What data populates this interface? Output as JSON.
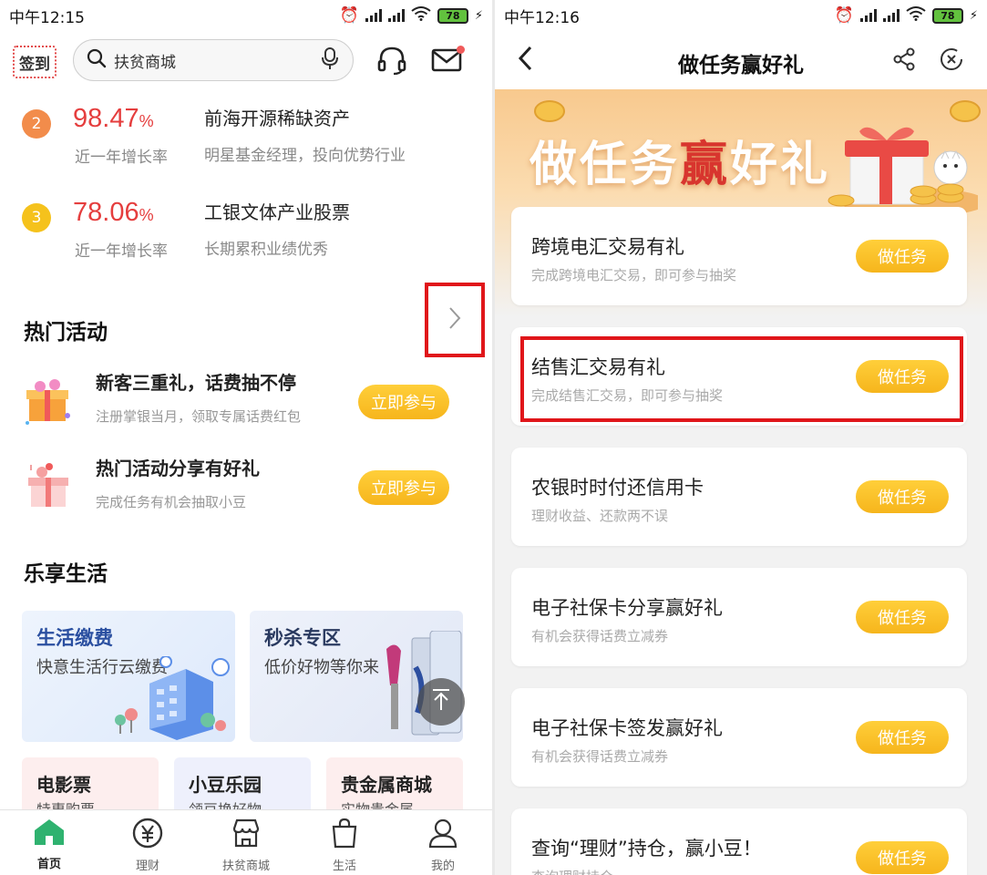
{
  "left": {
    "status": {
      "time": "中午12:15",
      "battery": "78"
    },
    "header": {
      "signin_label": "签到",
      "search_text": "扶贫商城"
    },
    "funds": [
      {
        "rank": "2",
        "rate": "98.47",
        "rate_unit": "%",
        "rate_label": "近一年增长率",
        "name": "前海开源稀缺资产",
        "desc": "明星基金经理，投向优势行业",
        "badge_color": "#f28c4b"
      },
      {
        "rank": "3",
        "rate": "78.06",
        "rate_unit": "%",
        "rate_label": "近一年增长率",
        "name": "工银文体产业股票",
        "desc": "长期累积业绩优秀",
        "badge_color": "#f5c21c"
      }
    ],
    "hot": {
      "title": "热门活动",
      "items": [
        {
          "title": "新客三重礼，话费抽不停",
          "desc": "注册掌银当月，领取专属话费红包",
          "button": "立即参与"
        },
        {
          "title": "热门活动分享有好礼",
          "desc": "完成任务有机会抽取小豆",
          "button": "立即参与"
        }
      ]
    },
    "life": {
      "title": "乐享生活",
      "cards": [
        {
          "title": "生活缴费",
          "sub": "快意生活行云缴费"
        },
        {
          "title": "秒杀专区",
          "sub": "低价好物等你来"
        }
      ],
      "small_cards": [
        {
          "title": "电影票",
          "sub": "特惠购票"
        },
        {
          "title": "小豆乐园",
          "sub": "领豆换好物"
        },
        {
          "title": "贵金属商城",
          "sub": "实物贵金属"
        }
      ]
    },
    "tabs": [
      {
        "label": "首页"
      },
      {
        "label": "理财"
      },
      {
        "label": "扶贫商城"
      },
      {
        "label": "生活"
      },
      {
        "label": "我的"
      }
    ]
  },
  "right": {
    "status": {
      "time": "中午12:16",
      "battery": "78"
    },
    "header": {
      "title": "做任务赢好礼"
    },
    "banner": {
      "part1": "做任务",
      "part2": "赢",
      "part3": "好礼"
    },
    "tasks": [
      {
        "title": "跨境电汇交易有礼",
        "desc": "完成跨境电汇交易，即可参与抽奖",
        "button": "做任务"
      },
      {
        "title": "结售汇交易有礼",
        "desc": "完成结售汇交易，即可参与抽奖",
        "button": "做任务"
      },
      {
        "title": "农银时时付还信用卡",
        "desc": "理财收益、还款两不误",
        "button": "做任务"
      },
      {
        "title": "电子社保卡分享赢好礼",
        "desc": "有机会获得话费立减券",
        "button": "做任务"
      },
      {
        "title": "电子社保卡签发赢好礼",
        "desc": "有机会获得话费立减券",
        "button": "做任务"
      },
      {
        "title": "查询“理财”持仓，赢小豆！",
        "desc": "查询理财持仓",
        "button": "做任务"
      }
    ]
  },
  "colors": {
    "accent_green": "#2fb26f",
    "button_yellow": "#f6b51c",
    "rate_red": "#e53e3e",
    "highlight_red": "#e0161a"
  }
}
